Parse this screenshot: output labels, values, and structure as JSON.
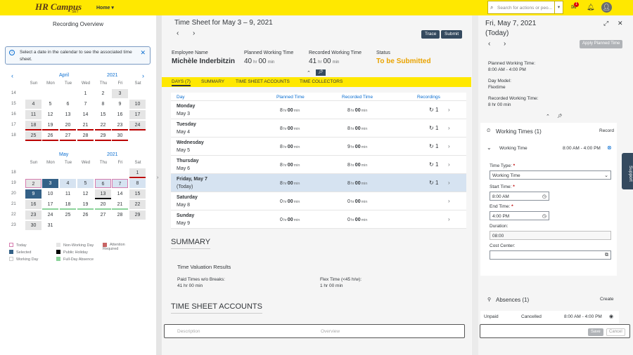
{
  "topbar": {
    "logo": "HR Campus",
    "logo_sub": "SET",
    "home": "Home",
    "search_placeholder": "Search for actions or peo...",
    "notif_count": "1"
  },
  "left": {
    "title": "Recording Overview",
    "info": "Select a date in the calendar to see the associated time sheet.",
    "april": {
      "month": "April",
      "year": "2021"
    },
    "may": {
      "month": "May",
      "year": "2021"
    },
    "weekdays": [
      "Sun",
      "Mon",
      "Tue",
      "Wed",
      "Thu",
      "Fri",
      "Sat"
    ],
    "legend": {
      "today": "Today",
      "selected": "Selected",
      "working": "Working Day",
      "nonworking": "Non-Working Day",
      "holiday": "Public Holiday",
      "absence": "Full-Day Absence",
      "attention": "Attention Required"
    }
  },
  "april_weeks": [
    {
      "wn": "14",
      "days": [
        {
          "c": 3,
          "t": "1",
          "s": "white"
        },
        {
          "c": 4,
          "t": "2",
          "s": "white"
        },
        {
          "c": 5,
          "t": "3",
          "s": "nw"
        }
      ]
    },
    {
      "wn": "15",
      "days": [
        {
          "c": 0,
          "t": "4",
          "s": "nw"
        },
        {
          "c": 1,
          "t": "5",
          "s": "white"
        },
        {
          "c": 2,
          "t": "6",
          "s": "white"
        },
        {
          "c": 3,
          "t": "7",
          "s": "white"
        },
        {
          "c": 4,
          "t": "8",
          "s": "white"
        },
        {
          "c": 5,
          "t": "9",
          "s": "white"
        },
        {
          "c": 6,
          "t": "10",
          "s": "nw"
        }
      ]
    },
    {
      "wn": "16",
      "days": [
        {
          "c": 0,
          "t": "11",
          "s": "nw"
        },
        {
          "c": 1,
          "t": "12",
          "s": "white"
        },
        {
          "c": 2,
          "t": "13",
          "s": "white"
        },
        {
          "c": 3,
          "t": "14",
          "s": "white"
        },
        {
          "c": 4,
          "t": "15",
          "s": "white"
        },
        {
          "c": 5,
          "t": "16",
          "s": "white"
        },
        {
          "c": 6,
          "t": "17",
          "s": "nw"
        }
      ]
    },
    {
      "wn": "17",
      "days": [
        {
          "c": 0,
          "t": "18",
          "s": "nw red"
        },
        {
          "c": 1,
          "t": "19",
          "s": "white red"
        },
        {
          "c": 2,
          "t": "20",
          "s": "white red"
        },
        {
          "c": 3,
          "t": "21",
          "s": "white red"
        },
        {
          "c": 4,
          "t": "22",
          "s": "white red"
        },
        {
          "c": 5,
          "t": "23",
          "s": "white red"
        },
        {
          "c": 6,
          "t": "24",
          "s": "nw red"
        }
      ]
    },
    {
      "wn": "18",
      "days": [
        {
          "c": 0,
          "t": "25",
          "s": "nw red"
        },
        {
          "c": 1,
          "t": "26",
          "s": "white red"
        },
        {
          "c": 2,
          "t": "27",
          "s": "white red"
        },
        {
          "c": 3,
          "t": "28",
          "s": "white red"
        },
        {
          "c": 4,
          "t": "29",
          "s": "white red"
        },
        {
          "c": 5,
          "t": "30",
          "s": "white red"
        }
      ]
    }
  ],
  "may_weeks": [
    {
      "wn": "18",
      "days": [
        {
          "c": 6,
          "t": "1",
          "s": "nw red"
        }
      ]
    },
    {
      "wn": "19",
      "days": [
        {
          "c": 0,
          "t": "2",
          "s": "nw today"
        },
        {
          "c": 1,
          "t": "3",
          "s": "sel"
        },
        {
          "c": 2,
          "t": "4",
          "s": "lb"
        },
        {
          "c": 3,
          "t": "5",
          "s": "lb"
        },
        {
          "c": 4,
          "t": "6",
          "s": "lb today"
        },
        {
          "c": 5,
          "t": "7",
          "s": "lb today"
        },
        {
          "c": 6,
          "t": "8",
          "s": "lb"
        }
      ]
    },
    {
      "wn": "20",
      "days": [
        {
          "c": 0,
          "t": "9",
          "s": "sel"
        },
        {
          "c": 1,
          "t": "10",
          "s": "white"
        },
        {
          "c": 2,
          "t": "11",
          "s": "white"
        },
        {
          "c": 3,
          "t": "12",
          "s": "white"
        },
        {
          "c": 4,
          "t": "13",
          "s": "nw black"
        },
        {
          "c": 5,
          "t": "14",
          "s": "white"
        },
        {
          "c": 6,
          "t": "15",
          "s": "nw"
        }
      ]
    },
    {
      "wn": "21",
      "days": [
        {
          "c": 0,
          "t": "16",
          "s": "nw"
        },
        {
          "c": 1,
          "t": "17",
          "s": "white green"
        },
        {
          "c": 2,
          "t": "18",
          "s": "white green"
        },
        {
          "c": 3,
          "t": "19",
          "s": "white green"
        },
        {
          "c": 4,
          "t": "20",
          "s": "white green"
        },
        {
          "c": 5,
          "t": "21",
          "s": "white green"
        },
        {
          "c": 6,
          "t": "22",
          "s": "nw"
        }
      ]
    },
    {
      "wn": "22",
      "days": [
        {
          "c": 0,
          "t": "23",
          "s": "nw"
        },
        {
          "c": 1,
          "t": "24",
          "s": "white"
        },
        {
          "c": 2,
          "t": "25",
          "s": "white"
        },
        {
          "c": 3,
          "t": "26",
          "s": "white"
        },
        {
          "c": 4,
          "t": "27",
          "s": "white"
        },
        {
          "c": 5,
          "t": "28",
          "s": "white"
        },
        {
          "c": 6,
          "t": "29",
          "s": "nw"
        }
      ]
    },
    {
      "wn": "23",
      "days": [
        {
          "c": 0,
          "t": "30",
          "s": "nw"
        },
        {
          "c": 1,
          "t": "31",
          "s": "white"
        }
      ]
    }
  ],
  "mid": {
    "title": "Time Sheet for May 3 – 9, 2021",
    "trace": "Trace",
    "submit": "Submit",
    "emp_label": "Employee Name",
    "emp": "Michèle Inderbitzin",
    "planned_label": "Planned Working Time",
    "planned_h": "40",
    "planned_m": "00",
    "recorded_label": "Recorded Working Time",
    "recorded_h": "41",
    "recorded_m": "00",
    "hr": "hr",
    "min": "min",
    "status_label": "Status",
    "status": "To be Submitted",
    "tabs": [
      "DAYS (7)",
      "SUMMARY",
      "TIME SHEET ACCOUNTS",
      "TIME COLLECTORS"
    ],
    "cols": [
      "Day",
      "Planned Time",
      "Recorded Time",
      "Recordings"
    ],
    "summary": "SUMMARY",
    "tvr": "Time Valuation Results",
    "paid_label": "Paid Times w/o Breaks:",
    "paid": "41 hr 00 min",
    "flex_label": "Flex Time (<45 h/w):",
    "flex": "1 hr 00 min",
    "accounts": "TIME SHEET ACCOUNTS",
    "acc_c1": "Description",
    "acc_c2": "Overview"
  },
  "rows": [
    {
      "day": "Monday",
      "date": "May 3",
      "ph": "8",
      "pm": "00",
      "rh": "8",
      "rm": "00",
      "rec": "1"
    },
    {
      "day": "Tuesday",
      "date": "May 4",
      "ph": "8",
      "pm": "00",
      "rh": "8",
      "rm": "00",
      "rec": "1"
    },
    {
      "day": "Wednesday",
      "date": "May 5",
      "ph": "8",
      "pm": "00",
      "rh": "9",
      "rm": "00",
      "rec": "1"
    },
    {
      "day": "Thursday",
      "date": "May 6",
      "ph": "8",
      "pm": "00",
      "rh": "8",
      "rm": "00",
      "rec": "1"
    },
    {
      "day": "Friday, May 7",
      "date": "(Today)",
      "ph": "8",
      "pm": "00",
      "rh": "8",
      "rm": "00",
      "rec": "1"
    },
    {
      "day": "Saturday",
      "date": "May 8",
      "ph": "0",
      "pm": "00",
      "rh": "0",
      "rm": "00",
      "rec": ""
    },
    {
      "day": "Sunday",
      "date": "May 9",
      "ph": "0",
      "pm": "00",
      "rh": "0",
      "rm": "00",
      "rec": ""
    }
  ],
  "right": {
    "title1": "Fri, May 7, 2021",
    "title2": "(Today)",
    "apply": "Apply Planned Time",
    "pwt_label": "Planned Working Time:",
    "pwt": "8:00 AM - 4:00 PM",
    "dm_label": "Day Model:",
    "dm": "Flextime",
    "rwt_label": "Recorded Working Time:",
    "rwt": "8 hr 00 min",
    "wt_title": "Working Times (1)",
    "record": "Record",
    "wt_item": "Working Time",
    "wt_range": "8:00 AM - 4:00 PM",
    "tt_label": "Time Type:",
    "tt": "Working Time",
    "st_label": "Start Time:",
    "st": "8:00 AM",
    "et_label": "End Time:",
    "et": "4:00 PM",
    "dur_label": "Duration:",
    "dur": "08:00",
    "cc_label": "Cost Center:",
    "abs_title": "Absences (1)",
    "create": "Create",
    "abs_type": "Unpaid",
    "abs_status": "Cancelled",
    "abs_range": "8:00 AM - 4:00 PM",
    "save": "Save",
    "cancel": "Cancel"
  },
  "support": "Support"
}
